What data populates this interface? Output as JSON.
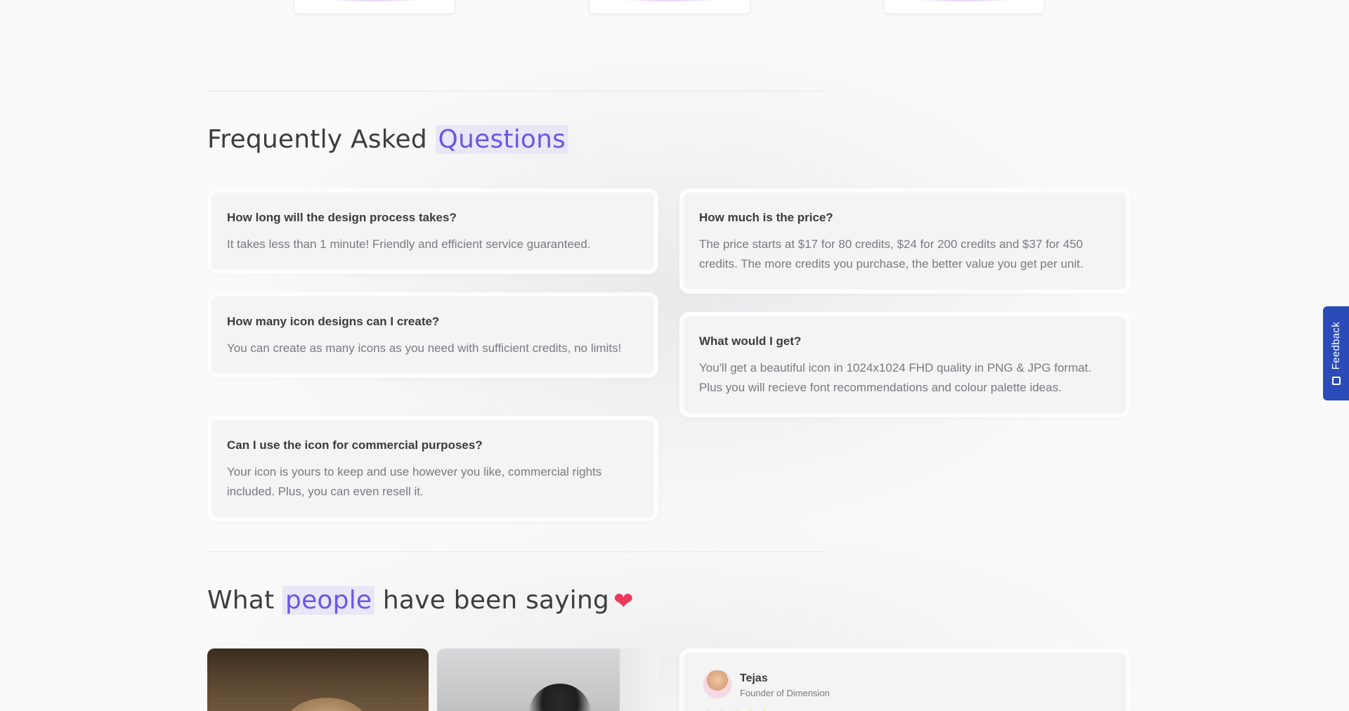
{
  "faq": {
    "title_prefix": "Frequently Asked ",
    "title_highlight": "Questions",
    "items": [
      {
        "q": "How long will the design process takes?",
        "a": "It takes less than 1 minute! Friendly and efficient service guaranteed."
      },
      {
        "q": "How much is the price?",
        "a": "The price starts at $17 for 80 credits, $24 for 200 credits and $37 for 450 credits. The more credits you purchase, the better value you get per unit."
      },
      {
        "q": "How many icon designs can I create?",
        "a": "You can create as many icons as you need with sufficient credits, no limits!"
      },
      {
        "q": "What would I get?",
        "a": "You'll get a beautiful icon in 1024x1024 FHD quality in PNG & JPG format. Plus you will recieve font recommendations and colour palette ideas."
      },
      {
        "q": "Can I use the icon for commercial purposes?",
        "a": "Your icon is yours to keep and use however you like, commercial rights included. Plus, you can even resell it."
      }
    ]
  },
  "testimonials": {
    "title_prefix": "What ",
    "title_highlight": "people",
    "title_suffix": " have been saying",
    "heart_glyph": "❤",
    "card": {
      "name": "Tejas",
      "role": "Founder of Dimension",
      "stars": "★★★★★"
    }
  },
  "feedback_tab": {
    "label": "Feedback",
    "icon": "feedback-smile-icon",
    "color": "#2b4bb8"
  },
  "colors": {
    "accent": "#6a58e0",
    "highlight_bg": "#e9e6f7",
    "heart": "#ec3a5c",
    "star": "#f3b52b"
  }
}
